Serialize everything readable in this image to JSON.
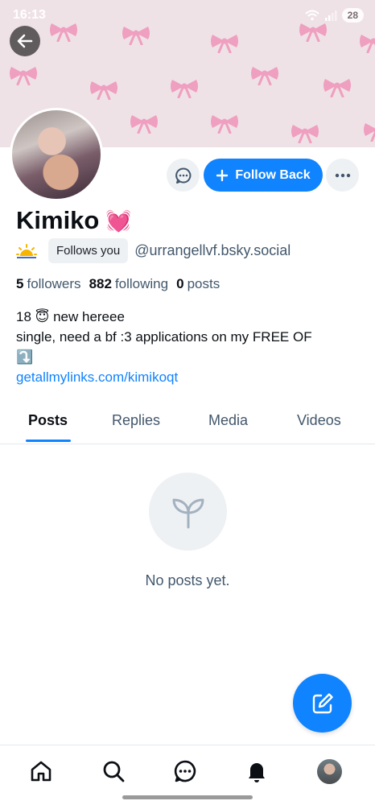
{
  "status_bar": {
    "time": "16:13",
    "battery": "28"
  },
  "banner": {
    "description_color": "#efe2e6",
    "bow_color": "#ef9fbf"
  },
  "header_actions": {
    "follow_label": "Follow Back"
  },
  "profile": {
    "display_name": "Kimiko",
    "name_emoji": "💓",
    "follows_badge": "Follows you",
    "handle": "@urrangellvf.bsky.social",
    "followers_count": "5",
    "followers_label": "followers",
    "following_count": "882",
    "following_label": "following",
    "posts_count": "0",
    "posts_label": "posts",
    "bio_line1": "18 😇 new hereee",
    "bio_line2": "single, need a bf :3 applications on my FREE OF",
    "bio_line3": "⤵️",
    "bio_link": "getallmylinks.com/kimikoqt"
  },
  "tabs": [
    "Posts",
    "Replies",
    "Media",
    "Videos"
  ],
  "active_tab": "Posts",
  "empty_state": {
    "text": "No posts yet."
  },
  "colors": {
    "accent": "#1083fe",
    "muted_text": "#42576c",
    "chip_bg": "#eef1f4"
  },
  "icons": {
    "back": "arrow-left-icon",
    "message": "chat-bubble-icon",
    "follow": "plus-icon",
    "more": "ellipsis-icon",
    "empty": "sprout-icon",
    "compose": "compose-icon",
    "nav": [
      "home-icon",
      "search-icon",
      "chat-icon",
      "bell-icon",
      "avatar"
    ]
  }
}
